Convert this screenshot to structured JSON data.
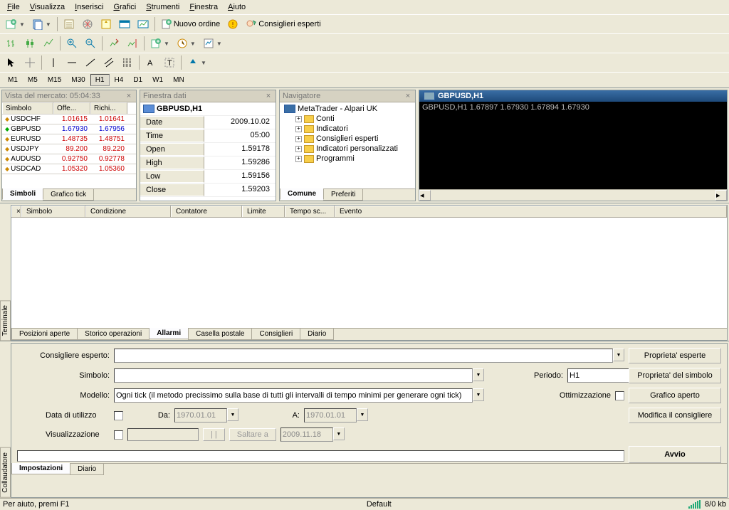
{
  "menu": [
    "File",
    "Visualizza",
    "Inserisci",
    "Grafici",
    "Strumenti",
    "Finestra",
    "Aiuto"
  ],
  "toolbar": {
    "new_order": "Nuovo ordine",
    "experts": "Consiglieri esperti"
  },
  "timeframes": [
    "M1",
    "M5",
    "M15",
    "M30",
    "H1",
    "H4",
    "D1",
    "W1",
    "MN"
  ],
  "tf_active": "H1",
  "market_watch": {
    "title": "Vista del mercato: 05:04:33",
    "cols": [
      "Simbolo",
      "Offe...",
      "Richi..."
    ],
    "rows": [
      {
        "s": "USDCHF",
        "b": "1.01615",
        "a": "1.01641",
        "d": "down"
      },
      {
        "s": "GBPUSD",
        "b": "1.67930",
        "a": "1.67956",
        "d": "up"
      },
      {
        "s": "EURUSD",
        "b": "1.48735",
        "a": "1.48751",
        "d": "down"
      },
      {
        "s": "USDJPY",
        "b": "89.200",
        "a": "89.220",
        "d": "down"
      },
      {
        "s": "AUDUSD",
        "b": "0.92750",
        "a": "0.92778",
        "d": "down"
      },
      {
        "s": "USDCAD",
        "b": "1.05320",
        "a": "1.05360",
        "d": "down"
      }
    ],
    "tabs": [
      "Simboli",
      "Grafico tick"
    ]
  },
  "data_window": {
    "title": "Finestra dati",
    "header": "GBPUSD,H1",
    "rows": [
      [
        "Date",
        "2009.10.02"
      ],
      [
        "Time",
        "05:00"
      ],
      [
        "Open",
        "1.59178"
      ],
      [
        "High",
        "1.59286"
      ],
      [
        "Low",
        "1.59156"
      ],
      [
        "Close",
        "1.59203"
      ]
    ]
  },
  "navigator": {
    "title": "Navigatore",
    "root": "MetaTrader - Alpari UK",
    "items": [
      "Conti",
      "Indicatori",
      "Consiglieri esperti",
      "Indicatori personalizzati",
      "Programmi"
    ],
    "tabs": [
      "Comune",
      "Preferiti"
    ]
  },
  "chart": {
    "title": "GBPUSD,H1",
    "line": "GBPUSD,H1 1.67897 1.67930 1.67894 1.67930"
  },
  "terminal": {
    "vtab": "Terminale",
    "cols": [
      "Simbolo",
      "Condizione",
      "Contatore",
      "Limite",
      "Tempo sc...",
      "Evento"
    ],
    "tabs": [
      "Posizioni aperte",
      "Storico operazioni",
      "Allarmi",
      "Casella postale",
      "Consiglieri",
      "Diario"
    ],
    "active_tab": "Allarmi"
  },
  "tester": {
    "vtab": "Collaudatore",
    "labels": {
      "expert": "Consigliere esperto:",
      "symbol": "Simbolo:",
      "model": "Modello:",
      "period": "Periodo:",
      "opt": "Ottimizzazione",
      "use_date": "Data di utilizzo",
      "from": "Da:",
      "to": "A:",
      "visual": "Visualizzazione",
      "skip": "Saltare a"
    },
    "model_value": "Ogni tick (il metodo precissimo sulla base di tutti gli intervalli di tempo minimi per generare ogni tick)",
    "period_value": "H1",
    "date1": "1970.01.01",
    "date2": "1970.01.01",
    "date3": "2009.11.18",
    "buttons": {
      "expert_props": "Proprieta' esperte",
      "symbol_props": "Proprieta' del simbolo",
      "open_chart": "Grafico aperto",
      "modify": "Modifica il consigliere",
      "start": "Avvio"
    },
    "tabs": [
      "Impostazioni",
      "Diario"
    ]
  },
  "status": {
    "help": "Per aiuto, premi F1",
    "profile": "Default",
    "kb": "8/0 kb"
  }
}
